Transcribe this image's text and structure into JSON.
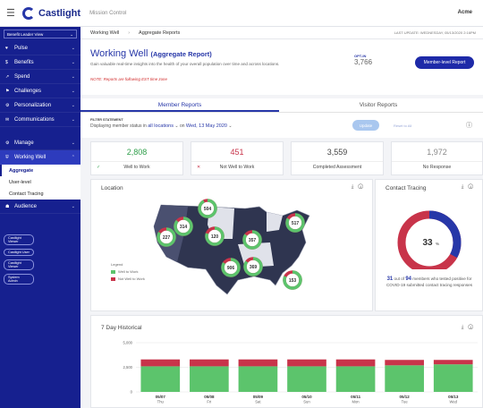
{
  "topbar": {
    "brand": "Castlight",
    "app_name": "Mission Control",
    "tenant": "Acme"
  },
  "sidebar": {
    "view_select": "Benefit Leader View",
    "items": [
      {
        "label": "Pulse",
        "icon": "heart-icon"
      },
      {
        "label": "Benefits",
        "icon": "coin-icon"
      },
      {
        "label": "Spend",
        "icon": "chart-icon"
      },
      {
        "label": "Challenges",
        "icon": "flag-icon"
      },
      {
        "label": "Personalization",
        "icon": "gear-icon"
      },
      {
        "label": "Communications",
        "icon": "mail-icon"
      }
    ],
    "manage": "Manage",
    "working_well": "Working Well",
    "sub_items": [
      "Aggregate",
      "User-level",
      "Contact Tracing"
    ],
    "audience": "Audience",
    "pills": [
      "Castlight Viewer",
      "Castlight User",
      "Castlight Viewer",
      "System Admin"
    ]
  },
  "breadcrumb": {
    "root": "Working Well",
    "current": "Aggregate Reports",
    "last_update": "LAST UPDATE: WEDNESDAY, 05/13/2020 2:16PM"
  },
  "header": {
    "title": "Working Well",
    "title_suffix": "(Aggregate Report)",
    "description": "Gain valuable real-time insights into the health of your overall population over time and across locations.",
    "note": "NOTE: Reports are following EST time zone",
    "optin_label": "OPT-IN",
    "optin_value": "3,766",
    "member_report_button": "Member-level Report"
  },
  "tabs": [
    "Member Reports",
    "Visitor Reports"
  ],
  "filter": {
    "label": "FILTER STATEMENT",
    "prefix": "Displaying member status in",
    "locations": "all locations",
    "on": "on",
    "date": "Wed, 13 May 2020",
    "update_button": "Update",
    "reset": "Reset to All"
  },
  "stats": [
    {
      "value": "2,808",
      "label": "Well to Work",
      "color": "#2e9e49",
      "mark": "✓"
    },
    {
      "value": "451",
      "label": "Not Well to Work",
      "color": "#c8344a",
      "mark": "✕"
    },
    {
      "value": "3,559",
      "label": "Completed Assessment",
      "color": "#444444",
      "mark": ""
    },
    {
      "value": "1,972",
      "label": "No Response",
      "color": "#888888",
      "mark": ""
    }
  ],
  "location": {
    "title": "Location",
    "legend_title": "Legend",
    "legend": [
      "Well to Work",
      "Not Well to Work"
    ],
    "bubbles": [
      {
        "value": "504",
        "well_fraction": 0.92
      },
      {
        "value": "314",
        "well_fraction": 0.86
      },
      {
        "value": "227",
        "well_fraction": 0.84
      },
      {
        "value": "120",
        "well_fraction": 0.8
      },
      {
        "value": "357",
        "well_fraction": 0.85
      },
      {
        "value": "517",
        "well_fraction": 0.83
      },
      {
        "value": "906",
        "well_fraction": 0.84
      },
      {
        "value": "369",
        "well_fraction": 0.85
      },
      {
        "value": "153",
        "well_fraction": 0.82
      }
    ]
  },
  "contact_tracing": {
    "title": "Contact Tracing",
    "percent": "33",
    "percent_value": 33,
    "count": "31",
    "mid": "out of",
    "total": "94",
    "suffix": "members who tested positive for COVID-19 submitted contact tracing responses"
  },
  "historical": {
    "title": "7 Day Historical"
  },
  "chart_data": {
    "type": "bar",
    "title": "7 Day Historical",
    "categories": [
      "05/07 Thu",
      "05/08 Fri",
      "05/09 Sat",
      "05/10 Sun",
      "05/11 Mon",
      "05/12 Tue",
      "05/13 Wed"
    ],
    "ytick_labels": [
      "0",
      "2,500",
      "5,000"
    ],
    "ylim": [
      0,
      5000
    ],
    "series": [
      {
        "values": [
          2600,
          2600,
          2600,
          2600,
          2600,
          2700,
          2800
        ],
        "color": "#5cc46c"
      },
      {
        "values": [
          700,
          700,
          700,
          700,
          700,
          550,
          450
        ],
        "color": "#c8344a"
      }
    ],
    "grid": true
  },
  "colors": {
    "brand_blue": "#16208f",
    "accent": "#2737a8",
    "well": "#5cc46c",
    "not_well": "#c8344a"
  }
}
